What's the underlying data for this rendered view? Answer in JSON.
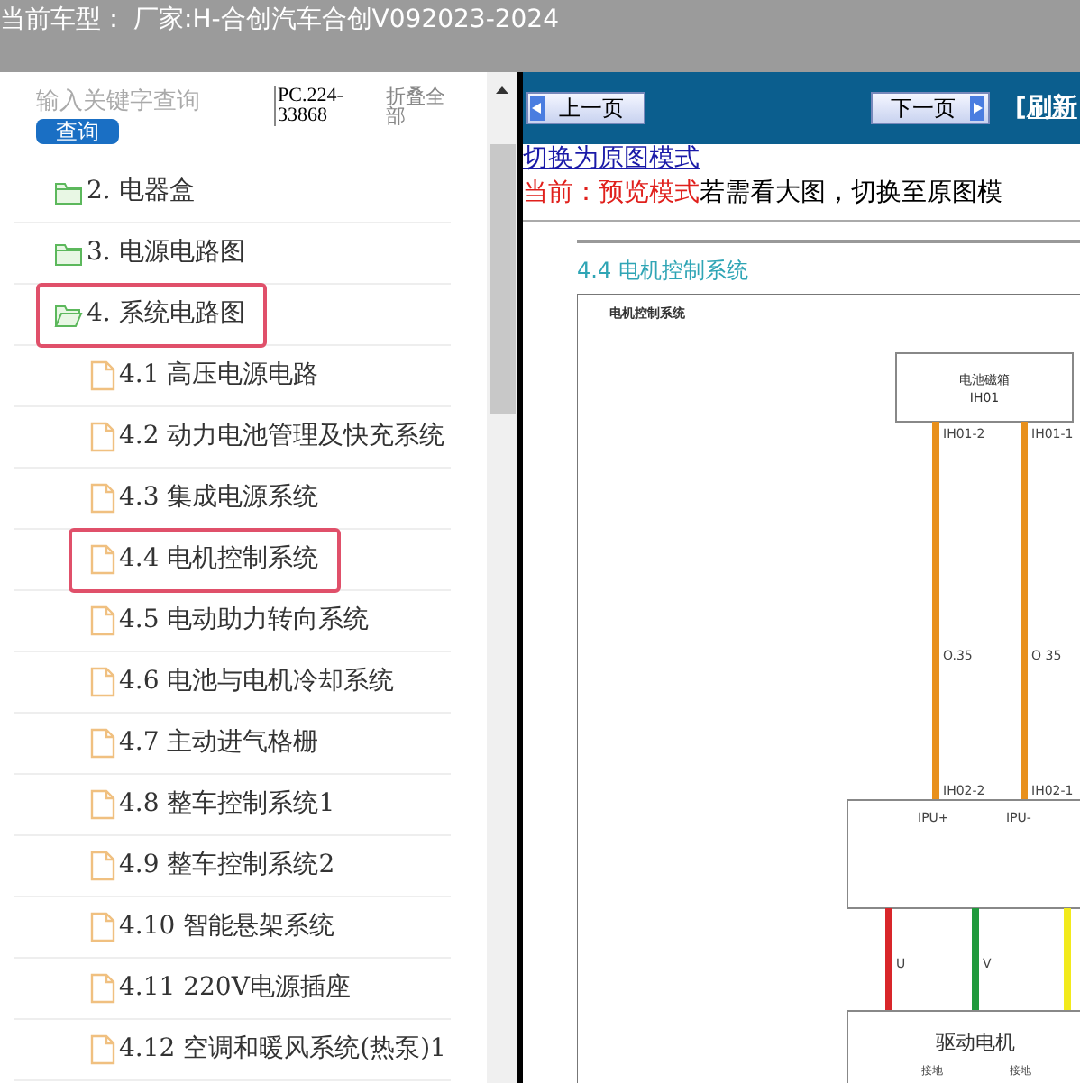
{
  "top_bar": {
    "label": "当前车型：",
    "value": "厂家:H-合创汽车合创V092023-2024"
  },
  "sidebar": {
    "search": {
      "placeholder": "输入关键字查询"
    },
    "search_button": "查询",
    "code": "PC.224-33868",
    "collapse_all": "折叠全部",
    "tree": [
      {
        "label": "2. 电器盒",
        "kind": "folder",
        "expanded": false,
        "highlighted": false
      },
      {
        "label": "3. 电源电路图",
        "kind": "folder",
        "expanded": false,
        "highlighted": false
      },
      {
        "label": "4. 系统电路图",
        "kind": "folder",
        "expanded": true,
        "highlighted": true,
        "children": [
          {
            "label": "4.1 高压电源电路",
            "kind": "page",
            "highlighted": false
          },
          {
            "label": "4.2 动力电池管理及快充系统",
            "kind": "page",
            "highlighted": false
          },
          {
            "label": "4.3 集成电源系统",
            "kind": "page",
            "highlighted": false
          },
          {
            "label": "4.4 电机控制系统",
            "kind": "page",
            "highlighted": true
          },
          {
            "label": "4.5 电动助力转向系统",
            "kind": "page",
            "highlighted": false
          },
          {
            "label": "4.6 电池与电机冷却系统",
            "kind": "page",
            "highlighted": false
          },
          {
            "label": "4.7 主动进气格栅",
            "kind": "page",
            "highlighted": false
          },
          {
            "label": "4.8 整车控制系统1",
            "kind": "page",
            "highlighted": false
          },
          {
            "label": "4.9 整车控制系统2",
            "kind": "page",
            "highlighted": false
          },
          {
            "label": "4.10 智能悬架系统",
            "kind": "page",
            "highlighted": false
          },
          {
            "label": "4.11 220V电源插座",
            "kind": "page",
            "highlighted": false
          },
          {
            "label": "4.12 空调和暖风系统(热泵)1",
            "kind": "page",
            "highlighted": false
          }
        ]
      }
    ]
  },
  "viewer": {
    "prev_button": "上一页",
    "next_button": "下一页",
    "refresh_link": "[刷新",
    "switch_link": "切换为原图模式",
    "mode_label": "当前：预览模式",
    "mode_hint": "若需看大图，切换至原图模",
    "document": {
      "heading": "4.4 电机控制系统",
      "diagram_title": "电机控制系统",
      "battery_box": [
        "电池磁箱",
        "IH01"
      ],
      "wires_top": [
        {
          "from": "IH01-2",
          "gauge": "O.35",
          "to": "IH02-2",
          "color": "#e8901c"
        },
        {
          "from": "IH01-1",
          "gauge": "O 35",
          "to": "IH02-1",
          "color": "#e8901c"
        }
      ],
      "ipu_labels": [
        "IPU+",
        "IPU-"
      ],
      "wires_bottom": [
        {
          "label": "U",
          "color": "#d8262a"
        },
        {
          "label": "V",
          "color": "#1f9a3c"
        },
        {
          "color": "#f2ea1c"
        }
      ],
      "motor": {
        "name": "驱动电机",
        "grounds": [
          "接地",
          "接地"
        ]
      }
    }
  }
}
